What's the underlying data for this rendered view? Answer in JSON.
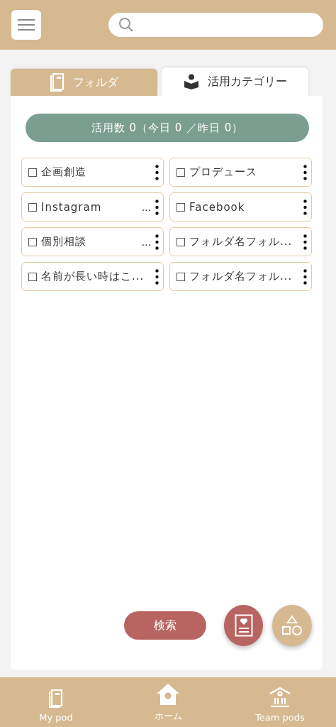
{
  "tabs": [
    {
      "label": "フォルダ",
      "selected": false
    },
    {
      "label": "活用カテゴリー",
      "selected": true
    }
  ],
  "usage_counter": "活用数 0（今日 0 ／昨日 0）",
  "categories": [
    {
      "label": "企画創造",
      "checked": false
    },
    {
      "label": "プロデュース",
      "checked": false
    },
    {
      "label": "Instagram",
      "suffix": "...",
      "checked": false
    },
    {
      "label": "Facebook",
      "checked": false
    },
    {
      "label": "個別相談",
      "suffix": "...",
      "checked": false
    },
    {
      "label": "フォルダ名フォル...",
      "checked": false
    },
    {
      "label": "名前が長い時はこ...",
      "checked": false
    },
    {
      "label": "フォルダ名フォル...",
      "checked": false
    }
  ],
  "search_button": "検索",
  "bottom_nav": [
    {
      "label": "My pod"
    },
    {
      "label": "ホーム"
    },
    {
      "label": "Team pods"
    }
  ]
}
